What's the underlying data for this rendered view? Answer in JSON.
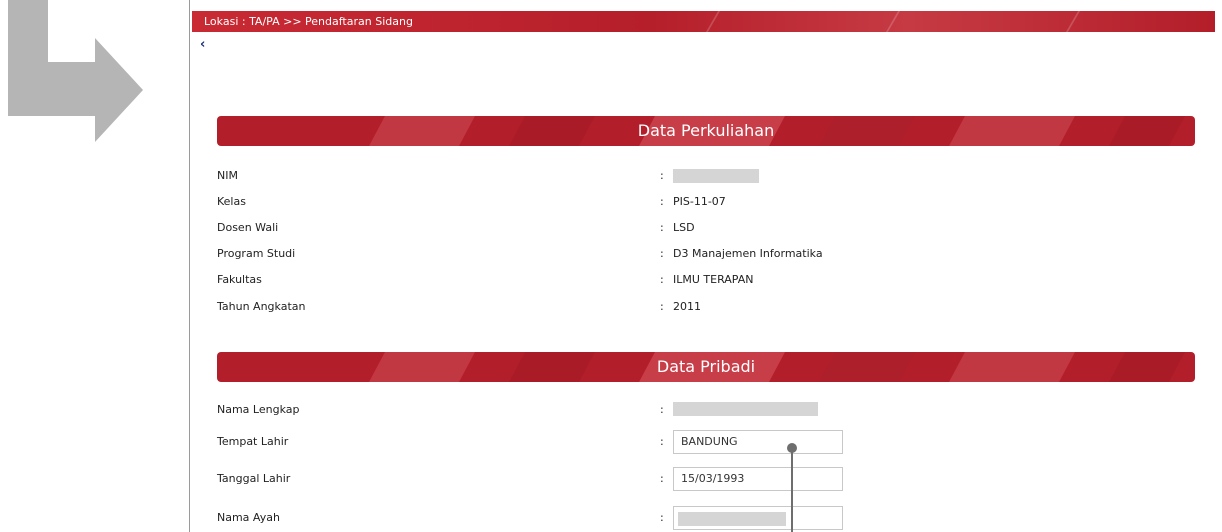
{
  "header": {
    "location": "Lokasi : TA/PA >> Pendaftaran Sidang",
    "back_icon": "chevron-left-icon"
  },
  "sections": {
    "perkuliahan": {
      "title": "Data Perkuliahan",
      "fields": [
        {
          "label": "NIM",
          "value": ""
        },
        {
          "label": "Kelas",
          "value": "PIS-11-07"
        },
        {
          "label": "Dosen Wali",
          "value": "LSD"
        },
        {
          "label": "Program Studi",
          "value": "D3 Manajemen Informatika"
        },
        {
          "label": "Fakultas",
          "value": "ILMU TERAPAN"
        },
        {
          "label": "Tahun Angkatan",
          "value": "2011"
        }
      ]
    },
    "pribadi": {
      "title": "Data Pribadi",
      "fields": [
        {
          "label": "Nama Lengkap",
          "value": ""
        },
        {
          "label": "Tempat Lahir",
          "value": "BANDUNG"
        },
        {
          "label": "Tanggal Lahir",
          "value": "15/03/1993"
        },
        {
          "label": "Nama Ayah",
          "value": ""
        }
      ]
    }
  },
  "colon": ":",
  "colors": {
    "accent_red": "#b21e2a",
    "arrow_gray": "#b5b5b5"
  }
}
